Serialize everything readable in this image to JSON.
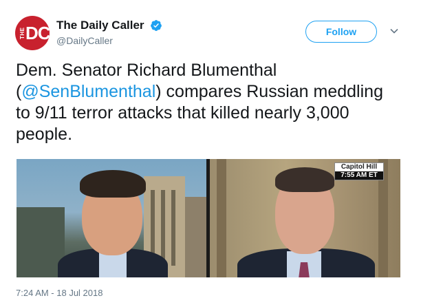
{
  "account": {
    "display_name": "The Daily Caller",
    "handle": "@DailyCaller",
    "avatar_text_small": "THE",
    "avatar_text_large": "DC",
    "verified": true,
    "verified_icon": "verified-badge-icon",
    "brand_color": "#c8212e"
  },
  "follow_button": {
    "label": "Follow"
  },
  "menu": {
    "icon": "chevron-down-icon"
  },
  "tweet": {
    "text_before": "Dem. Senator Richard Blumenthal (",
    "mention": "@SenBlumenthal",
    "text_after": ") compares Russian meddling to 9/11 terror attacks that killed nearly 3,000 people."
  },
  "media": {
    "location_label": "Capitol Hill",
    "time_label": "7:55 AM ET"
  },
  "timestamp": "7:24 AM - 18 Jul 2018",
  "colors": {
    "link": "#1b95e0",
    "follow_border": "#1da1f2",
    "secondary_text": "#657786",
    "primary_text": "#14171a"
  }
}
